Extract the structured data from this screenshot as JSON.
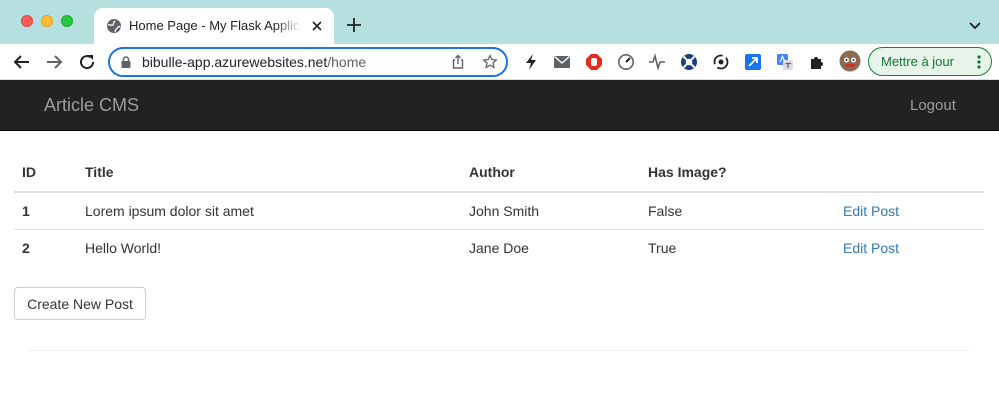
{
  "browser": {
    "tab_title": "Home Page - My Flask Application",
    "url_host": "bibulle-app.azurewebsites.net",
    "url_path": "/home",
    "update_label": "Mettre à jour"
  },
  "navbar": {
    "brand": "Article CMS",
    "logout_label": "Logout"
  },
  "table": {
    "headers": {
      "id": "ID",
      "title": "Title",
      "author": "Author",
      "has_image": "Has Image?"
    },
    "rows": [
      {
        "id": "1",
        "title": "Lorem ipsum dolor sit amet",
        "author": "John Smith",
        "has_image": "False",
        "action": "Edit Post"
      },
      {
        "id": "2",
        "title": "Hello World!",
        "author": "Jane Doe",
        "has_image": "True",
        "action": "Edit Post"
      }
    ]
  },
  "create_button_label": "Create New Post",
  "colors": {
    "tabstrip": "#b5e0df",
    "navbar": "#222222",
    "link": "#337ab7",
    "omnibox_focus": "#1a73e8"
  },
  "extensions": [
    "bolt-icon",
    "mail-icon",
    "stop-icon",
    "speedometer-icon",
    "waveform-icon",
    "lifebuoy-icon",
    "sync-icon",
    "resize-icon",
    "translate-icon",
    "puzzle-icon",
    "avatar"
  ]
}
